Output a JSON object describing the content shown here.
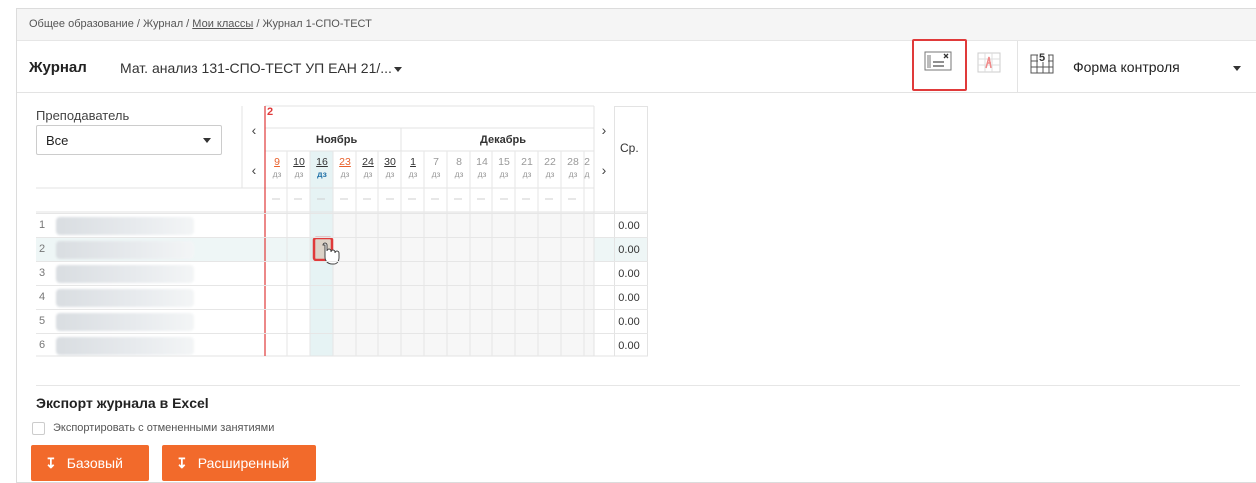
{
  "breadcrumb": {
    "part1": "Общее образование / Журнал / ",
    "link": "Мои классы",
    "part2": " / Журнал 1-СПО-ТЕСТ"
  },
  "header": {
    "title": "Журнал",
    "subject": "Мат. анализ 131-СПО-ТЕСТ УП ЕАН 21/...",
    "form_control_label": "Форма контроля"
  },
  "filter": {
    "teacher_label": "Преподаватель",
    "teacher_value": "Все"
  },
  "journal": {
    "marker": "2",
    "months": [
      "Ноябрь",
      "Декабрь"
    ],
    "days": [
      {
        "num": "9",
        "sub": "дз",
        "style": "red"
      },
      {
        "num": "10",
        "sub": "дз",
        "style": "dark"
      },
      {
        "num": "16",
        "sub": "дз",
        "style": "dark",
        "active": true
      },
      {
        "num": "23",
        "sub": "дз",
        "style": "red"
      },
      {
        "num": "24",
        "sub": "дз",
        "style": "dark"
      },
      {
        "num": "30",
        "sub": "дз",
        "style": "dark"
      },
      {
        "num": "1",
        "sub": "дз",
        "style": "dark"
      },
      {
        "num": "7",
        "sub": "дз",
        "style": "grey"
      },
      {
        "num": "8",
        "sub": "дз",
        "style": "grey"
      },
      {
        "num": "14",
        "sub": "дз",
        "style": "grey"
      },
      {
        "num": "15",
        "sub": "дз",
        "style": "grey"
      },
      {
        "num": "21",
        "sub": "дз",
        "style": "grey"
      },
      {
        "num": "22",
        "sub": "дз",
        "style": "grey"
      },
      {
        "num": "28",
        "sub": "дз",
        "style": "grey"
      },
      {
        "num": "2",
        "sub": "д",
        "style": "grey"
      }
    ],
    "avg_header": "Ср.",
    "rows": [
      {
        "num": "1",
        "avg": "0.00"
      },
      {
        "num": "2",
        "avg": "0.00"
      },
      {
        "num": "3",
        "avg": "0.00"
      },
      {
        "num": "4",
        "avg": "0.00"
      },
      {
        "num": "5",
        "avg": "0.00"
      },
      {
        "num": "6",
        "avg": "0.00"
      }
    ]
  },
  "export": {
    "title": "Экспорт журнала в Excel",
    "checkbox_label": "Экспортировать с отмененными занятиями",
    "basic_button": "Базовый",
    "extended_button": "Расширенный"
  },
  "colors": {
    "accent": "#f26a2b",
    "highlight": "#e03a3a",
    "active_column": "#e6f3f4",
    "active_row": "#eef6f6"
  }
}
